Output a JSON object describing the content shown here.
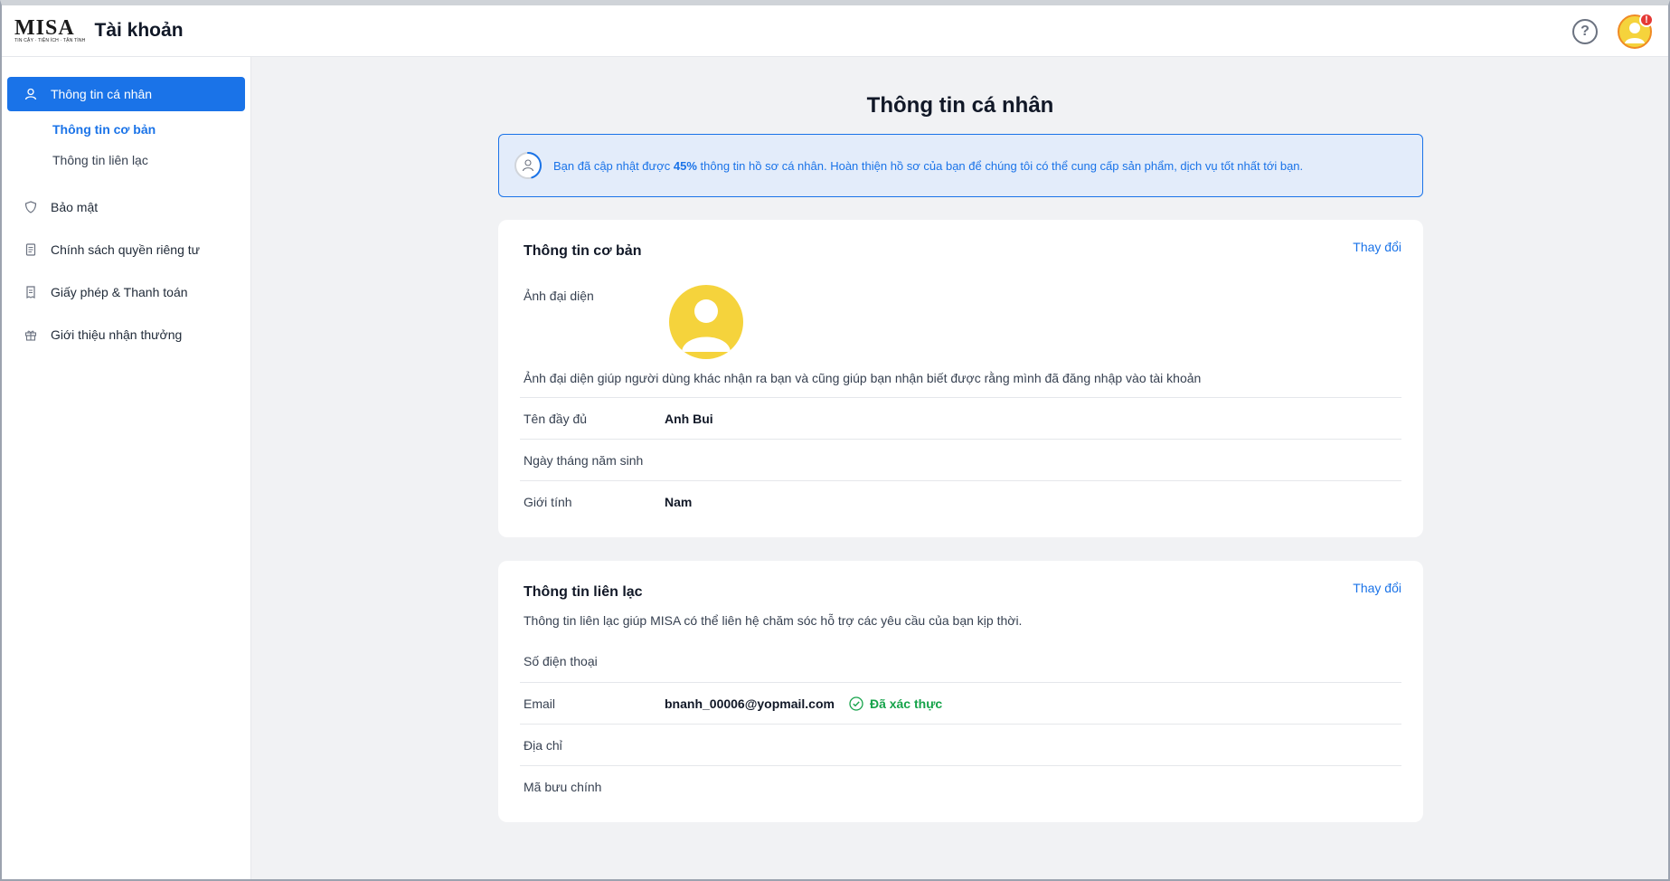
{
  "header": {
    "logo_word": "MISA",
    "logo_tagline": "TIN CẬY · TIỆN ÍCH · TẬN TÌNH",
    "app_title": "Tài khoản",
    "help_icon": "question-circle-icon",
    "notification_badge": "!"
  },
  "sidebar": {
    "items": [
      {
        "label": "Thông tin cá nhân",
        "icon": "user-icon",
        "active": true
      },
      {
        "label": "Bảo mật",
        "icon": "shield-icon",
        "active": false
      },
      {
        "label": "Chính sách quyền riêng tư",
        "icon": "document-icon",
        "active": false
      },
      {
        "label": "Giấy phép & Thanh toán",
        "icon": "receipt-icon",
        "active": false
      },
      {
        "label": "Giới thiệu nhận thưởng",
        "icon": "gift-icon",
        "active": false
      }
    ],
    "sub_items": [
      {
        "label": "Thông tin cơ bản",
        "active": true
      },
      {
        "label": "Thông tin liên lạc",
        "active": false
      }
    ]
  },
  "main": {
    "page_title": "Thông tin cá nhân",
    "banner": {
      "progress_percent": 45,
      "text_before": "Bạn đã cập nhật được ",
      "percent_label": "45%",
      "text_after": " thông tin hồ sơ cá nhân. Hoàn thiện hồ sơ của bạn để chúng tôi có thể cung cấp sản phẩm, dịch vụ tốt nhất tới bạn."
    },
    "basic_info": {
      "title": "Thông tin cơ bản",
      "action": "Thay đổi",
      "avatar_label": "Ảnh đại diện",
      "avatar_desc": "Ảnh đại diện giúp người dùng khác nhận ra bạn và cũng giúp bạn nhận biết được rằng mình đã đăng nhập vào tài khoản",
      "fields": [
        {
          "label": "Tên đầy đủ",
          "value": "Anh Bui"
        },
        {
          "label": "Ngày tháng năm sinh",
          "value": ""
        },
        {
          "label": "Giới tính",
          "value": "Nam"
        }
      ]
    },
    "contact_info": {
      "title": "Thông tin liên lạc",
      "action": "Thay đổi",
      "desc": "Thông tin liên lạc giúp MISA có thể liên hệ chăm sóc hỗ trợ các yêu cầu của bạn kịp thời.",
      "fields": [
        {
          "label": "Số điện thoại",
          "value": ""
        },
        {
          "label": "Email",
          "value": "bnanh_00006@yopmail.com",
          "status": "Đã xác thực"
        },
        {
          "label": "Địa chỉ",
          "value": ""
        },
        {
          "label": "Mã bưu chính",
          "value": ""
        }
      ]
    }
  },
  "colors": {
    "accent": "#1a73e8",
    "avatar": "#f5d33c",
    "verified": "#16a34a",
    "badge": "#e53935"
  }
}
